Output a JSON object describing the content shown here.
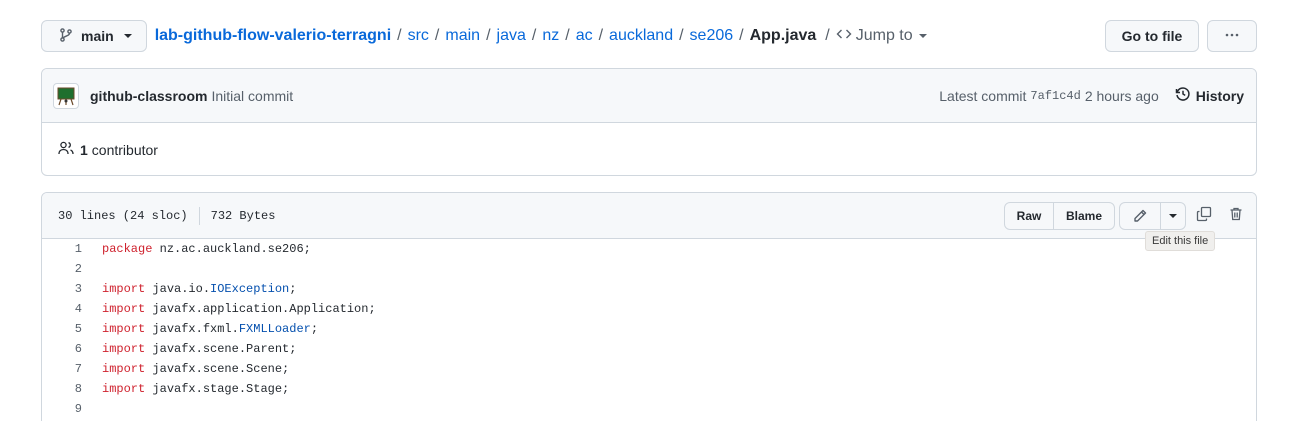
{
  "nav": {
    "branch": "main",
    "breadcrumbs": [
      {
        "label": "lab-github-flow-valerio-terragni"
      },
      {
        "label": "src"
      },
      {
        "label": "main"
      },
      {
        "label": "java"
      },
      {
        "label": "nz"
      },
      {
        "label": "ac"
      },
      {
        "label": "auckland"
      },
      {
        "label": "se206"
      }
    ],
    "separator": "/",
    "file_name": "App.java",
    "jump_label": "Jump to",
    "go_to_file_label": "Go to file",
    "more_label": "···"
  },
  "commit": {
    "author": "github-classroom",
    "message": "Initial commit",
    "latest_label": "Latest commit",
    "sha": "7af1c4d",
    "time": "2 hours ago",
    "history_label": "History",
    "contributor_count": "1",
    "contributor_label": "contributor"
  },
  "file": {
    "lines_info": "30 lines (24 sloc)",
    "size": "732 Bytes",
    "raw_label": "Raw",
    "blame_label": "Blame",
    "tooltip": "Edit this file"
  },
  "code": {
    "lines": [
      {
        "n": "1",
        "kw": "package",
        "rest": " nz.ac.auckland.se206;",
        "type": "",
        "tail": ""
      },
      {
        "n": "2",
        "kw": "",
        "rest": "",
        "type": "",
        "tail": ""
      },
      {
        "n": "3",
        "kw": "import",
        "rest": " java.io.",
        "type": "IOException",
        "tail": ";"
      },
      {
        "n": "4",
        "kw": "import",
        "rest": " javafx.application.Application;",
        "type": "",
        "tail": ""
      },
      {
        "n": "5",
        "kw": "import",
        "rest": " javafx.fxml.",
        "type": "FXMLLoader",
        "tail": ";"
      },
      {
        "n": "6",
        "kw": "import",
        "rest": " javafx.scene.Parent;",
        "type": "",
        "tail": ""
      },
      {
        "n": "7",
        "kw": "import",
        "rest": " javafx.scene.Scene;",
        "type": "",
        "tail": ""
      },
      {
        "n": "8",
        "kw": "import",
        "rest": " javafx.stage.Stage;",
        "type": "",
        "tail": ""
      },
      {
        "n": "9",
        "kw": "",
        "rest": "",
        "type": "",
        "tail": ""
      }
    ]
  },
  "colors": {
    "link": "#0969da",
    "keyword": "#cf222e",
    "type": "#0550ae",
    "muted": "#57606a"
  }
}
